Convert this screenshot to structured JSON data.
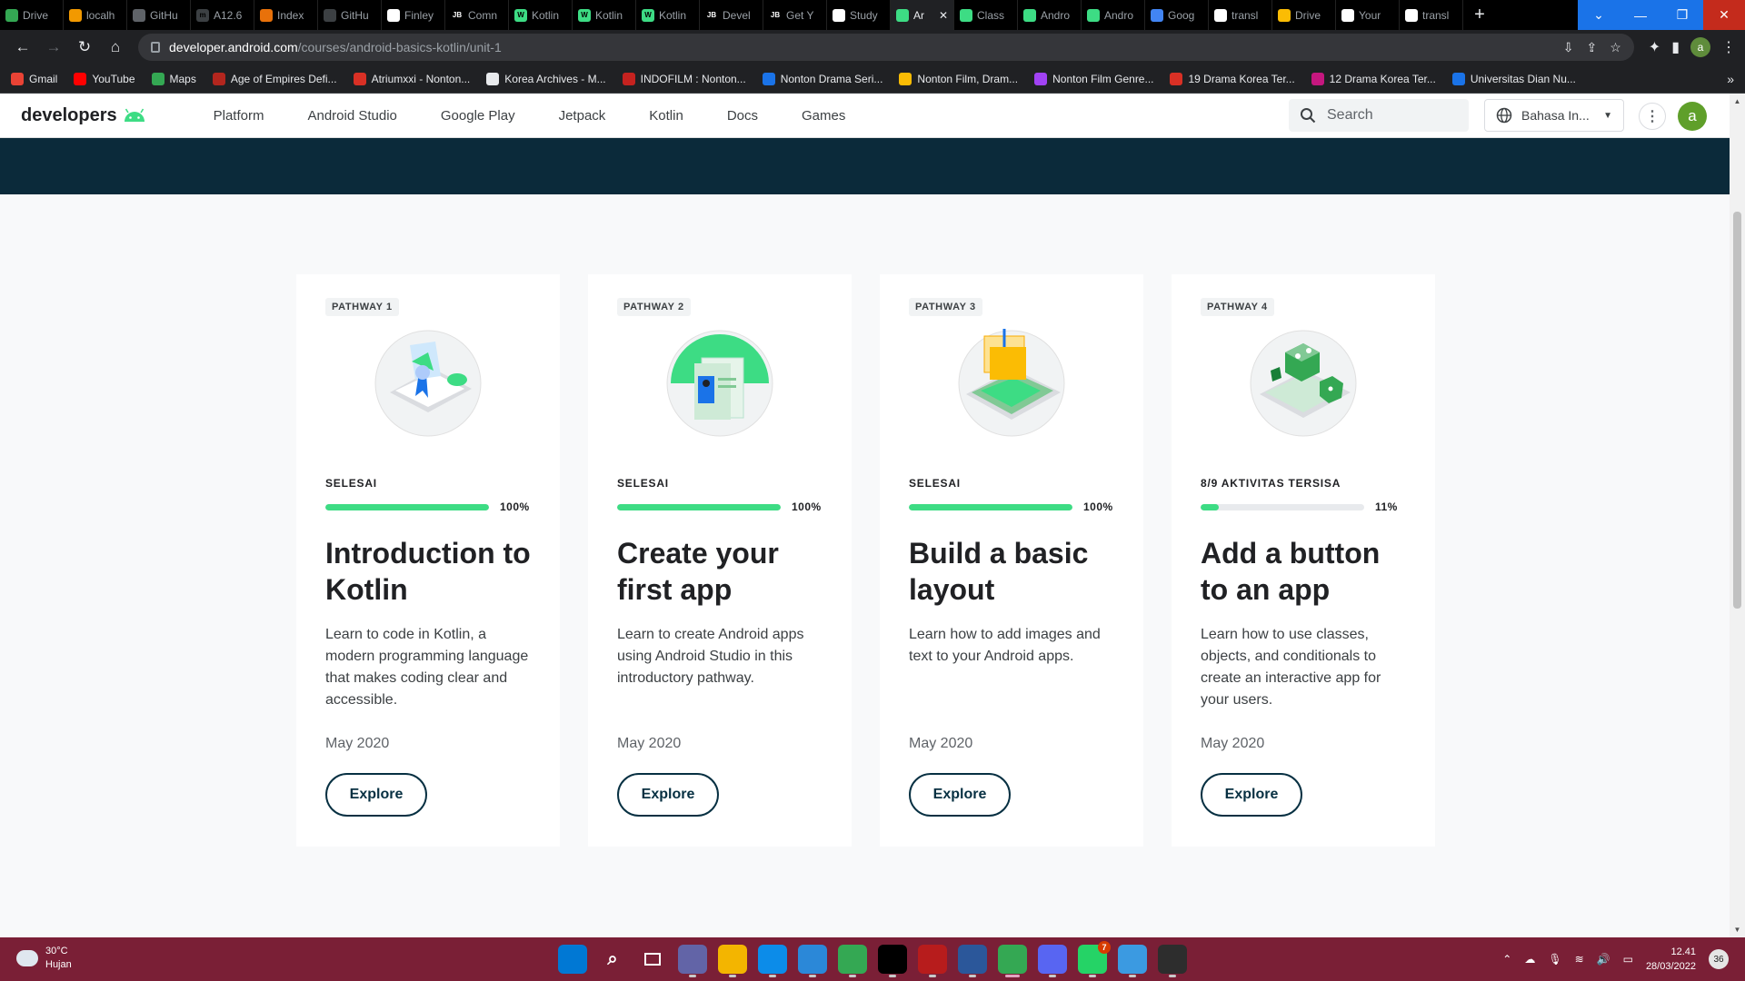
{
  "browser": {
    "tabs": [
      {
        "label": "Drive",
        "color": "#34a853",
        "glyph": ""
      },
      {
        "label": "localh",
        "color": "#f29900",
        "glyph": ""
      },
      {
        "label": "GitHu",
        "color": "#5f6368",
        "glyph": ""
      },
      {
        "label": "A12.6",
        "color": "#3c4043",
        "glyph": "m"
      },
      {
        "label": "Index",
        "color": "#e8710a",
        "glyph": ""
      },
      {
        "label": "GitHu",
        "color": "#3c4043",
        "glyph": ""
      },
      {
        "label": "Finley",
        "color": "#ffffff",
        "glyph": ""
      },
      {
        "label": "Comn",
        "color": "#000000",
        "glyph": "JB"
      },
      {
        "label": "Kotlin",
        "color": "#3ddc84",
        "glyph": "W"
      },
      {
        "label": "Kotlin",
        "color": "#3ddc84",
        "glyph": "W"
      },
      {
        "label": "Kotlin",
        "color": "#3ddc84",
        "glyph": "W"
      },
      {
        "label": "Devel",
        "color": "#000000",
        "glyph": "JB"
      },
      {
        "label": "Get Y",
        "color": "#000000",
        "glyph": "JB"
      },
      {
        "label": "Study",
        "color": "#ffffff",
        "glyph": ""
      },
      {
        "label": "Ar",
        "color": "#3ddc84",
        "glyph": "",
        "active": true
      },
      {
        "label": "Class",
        "color": "#3ddc84",
        "glyph": ""
      },
      {
        "label": "Andro",
        "color": "#3ddc84",
        "glyph": ""
      },
      {
        "label": "Andro",
        "color": "#3ddc84",
        "glyph": ""
      },
      {
        "label": "Goog",
        "color": "#4285f4",
        "glyph": ""
      },
      {
        "label": "transl",
        "color": "#ffffff",
        "glyph": ""
      },
      {
        "label": "Drive",
        "color": "#fbbc04",
        "glyph": ""
      },
      {
        "label": "Your",
        "color": "#ffffff",
        "glyph": ""
      },
      {
        "label": "transl",
        "color": "#ffffff",
        "glyph": ""
      }
    ],
    "url_host": "developer.android.com",
    "url_path": "/courses/android-basics-kotlin/unit-1",
    "profile_initial": "a",
    "bookmarks": [
      {
        "label": "Gmail",
        "color": "#ea4335"
      },
      {
        "label": "YouTube",
        "color": "#ff0000"
      },
      {
        "label": "Maps",
        "color": "#34a853"
      },
      {
        "label": "Age of Empires Defi...",
        "color": "#b3261e"
      },
      {
        "label": "Atriumxxi - Nonton...",
        "color": "#d93025"
      },
      {
        "label": "Korea Archives - M...",
        "color": "#e8eaed"
      },
      {
        "label": "INDOFILM : Nonton...",
        "color": "#c5221f"
      },
      {
        "label": "Nonton Drama Seri...",
        "color": "#1a73e8"
      },
      {
        "label": "Nonton Film, Dram...",
        "color": "#fbbc04"
      },
      {
        "label": "Nonton Film Genre...",
        "color": "#a142f4"
      },
      {
        "label": "19 Drama Korea Ter...",
        "color": "#d93025"
      },
      {
        "label": "12 Drama Korea Ter...",
        "color": "#c5177f"
      },
      {
        "label": "Universitas Dian Nu...",
        "color": "#1a73e8"
      }
    ]
  },
  "site": {
    "logo_text": "developers",
    "nav": [
      "Platform",
      "Android Studio",
      "Google Play",
      "Jetpack",
      "Kotlin",
      "Docs",
      "Games"
    ],
    "search_placeholder": "Search",
    "language": "Bahasa In...",
    "user_initial": "a"
  },
  "pathways": [
    {
      "chip": "PATHWAY 1",
      "status": "SELESAI",
      "progress": 100,
      "pct_label": "100%",
      "title": "Introduction to Kotlin",
      "description": "Learn to code in Kotlin, a modern programming language that makes coding clear and accessible.",
      "date": "May 2020",
      "button": "Explore"
    },
    {
      "chip": "PATHWAY 2",
      "status": "SELESAI",
      "progress": 100,
      "pct_label": "100%",
      "title": "Create your first app",
      "description": "Learn to create Android apps using Android Studio in this introductory pathway.",
      "date": "May 2020",
      "button": "Explore"
    },
    {
      "chip": "PATHWAY 3",
      "status": "SELESAI",
      "progress": 100,
      "pct_label": "100%",
      "title": "Build a basic layout",
      "description": "Learn how to add images and text to your Android apps.",
      "date": "May 2020",
      "button": "Explore"
    },
    {
      "chip": "PATHWAY 4",
      "status": "8/9 AKTIVITAS TERSISA",
      "progress": 11,
      "pct_label": "11%",
      "title": "Add a button to an app",
      "description": "Learn how to use classes, objects, and conditionals to create an interactive app for your users.",
      "date": "May 2020",
      "button": "Explore"
    }
  ],
  "taskbar": {
    "temperature": "30°C",
    "weather": "Hujan",
    "apps": [
      {
        "name": "start",
        "color": "#0078d4"
      },
      {
        "name": "search",
        "color": "transparent"
      },
      {
        "name": "task-view",
        "color": "transparent"
      },
      {
        "name": "teams-chat",
        "color": "#6264a7"
      },
      {
        "name": "file-explorer",
        "color": "#f3b500"
      },
      {
        "name": "edge",
        "color": "#0c8ce9"
      },
      {
        "name": "store",
        "color": "#2b88d8"
      },
      {
        "name": "chrome",
        "color": "#34a853"
      },
      {
        "name": "intellij",
        "color": "#000000"
      },
      {
        "name": "app-red",
        "color": "#b71c1c"
      },
      {
        "name": "word-like",
        "color": "#2b579a"
      },
      {
        "name": "chrome-active",
        "color": "#34a853",
        "active": true
      },
      {
        "name": "discord",
        "color": "#5865f2"
      },
      {
        "name": "whatsapp",
        "color": "#25d366",
        "badge": "7"
      },
      {
        "name": "notepad",
        "color": "#3b9ae1"
      },
      {
        "name": "terminal",
        "color": "#2d2d2d"
      }
    ],
    "time": "12.41",
    "date": "28/03/2022",
    "notification_count": "36"
  }
}
